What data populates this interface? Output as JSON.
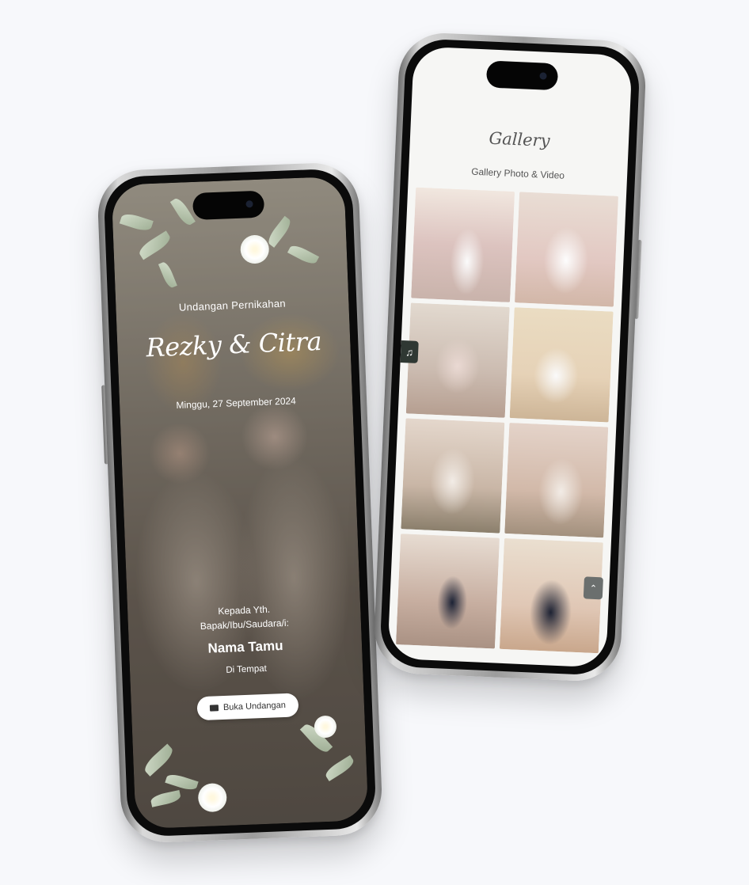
{
  "left_screen": {
    "intro": "Undangan Pernikahan",
    "names": "Rezky & Citra",
    "date": "Minggu, 27 September 2024",
    "recipient_line1": "Kepada Yth.",
    "recipient_line2": "Bapak/Ibu/Saudara/i:",
    "guest_name": "Nama Tamu",
    "guest_place": "Di Tempat",
    "open_button": "Buka Undangan",
    "open_icon": "envelope-icon"
  },
  "right_screen": {
    "title": "Gallery",
    "subtitle": "Gallery Photo & Video",
    "music_icon": "♫",
    "scroll_top_icon": "⌃",
    "photo_count": 8
  },
  "colors": {
    "background": "#f7f8fb",
    "frame": "#b3b3b3",
    "music_button": "#2f3833",
    "scroll_button": "#6b6f6e",
    "button_bg": "#ffffff"
  }
}
